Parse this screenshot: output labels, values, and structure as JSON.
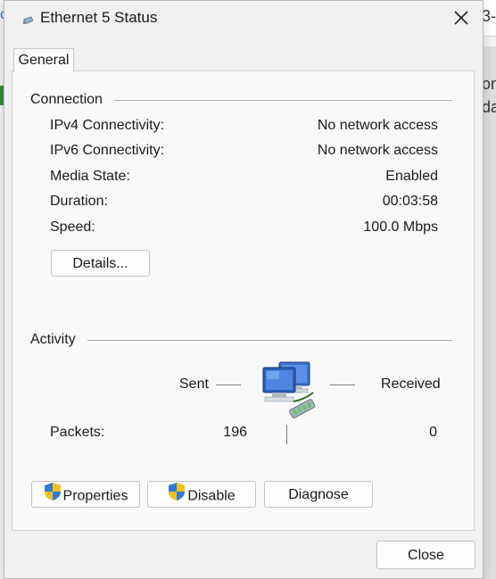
{
  "window": {
    "title": "Ethernet 5 Status",
    "close_glyph": "✕"
  },
  "background": {
    "partial_text_1": "ᴏn",
    "partial_text_2": "da",
    "partial_text_3": "3-",
    "partial_text_4": "c"
  },
  "tabs": [
    {
      "label": "General"
    }
  ],
  "connection": {
    "header": "Connection",
    "rows": [
      {
        "label": "IPv4 Connectivity:",
        "value": "No network access"
      },
      {
        "label": "IPv6 Connectivity:",
        "value": "No network access"
      },
      {
        "label": "Media State:",
        "value": "Enabled"
      },
      {
        "label": "Duration:",
        "value": "00:03:58"
      },
      {
        "label": "Speed:",
        "value": "100.0 Mbps"
      }
    ],
    "details_button": "Details..."
  },
  "activity": {
    "header": "Activity",
    "sent_label": "Sent",
    "received_label": "Received",
    "packets_label": "Packets:",
    "packets_sent": "196",
    "packets_received": "0"
  },
  "buttons": {
    "properties": "Properties",
    "disable": "Disable",
    "diagnose": "Diagnose",
    "close": "Close"
  },
  "icons": {
    "title_icon": "network-adapter-icon",
    "activity_icon": "network-computers-icon",
    "shield_icon": "uac-shield-icon"
  }
}
